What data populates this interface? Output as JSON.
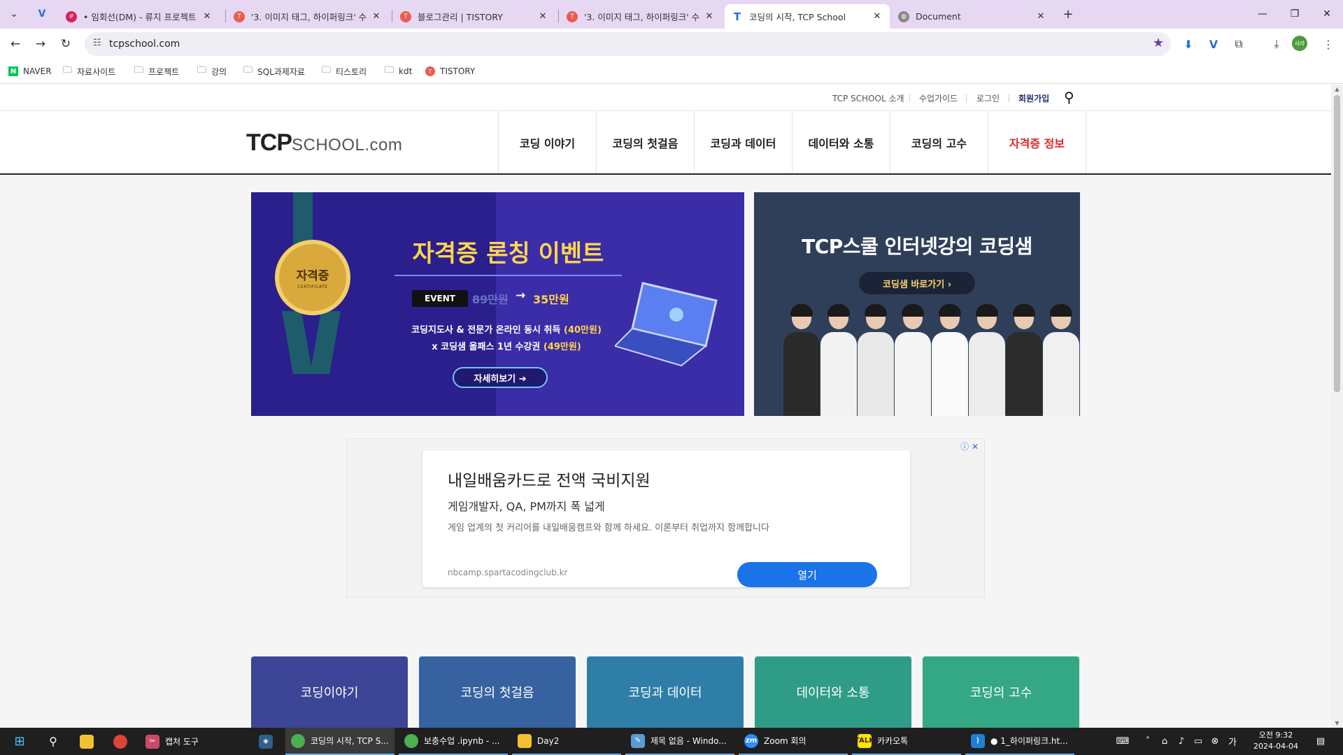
{
  "browser": {
    "tabs": [
      {
        "label": "• 임회선(DM) - 류지 프로젝트",
        "favicon": "slack-icon"
      },
      {
        "label": "'3. 이미지 태그, 하이퍼링크' 수",
        "favicon": "tistory-icon"
      },
      {
        "label": "블로그관리 | TISTORY",
        "favicon": "tistory-icon"
      },
      {
        "label": "'3. 이미지 태그, 하이퍼링크' 수",
        "favicon": "tistory-icon"
      },
      {
        "label": "코딩의 시작, TCP School",
        "favicon": "tcp-icon",
        "active": true
      },
      {
        "label": "Document",
        "favicon": "globe-icon"
      }
    ],
    "url": "tcpschool.com",
    "bookmarks": [
      {
        "label": "NAVER",
        "icon": "naver-icon"
      },
      {
        "label": "자료사이트",
        "icon": "folder-icon"
      },
      {
        "label": "프로젝트",
        "icon": "folder-icon"
      },
      {
        "label": "강의",
        "icon": "folder-icon"
      },
      {
        "label": "SQL과제자료",
        "icon": "folder-icon"
      },
      {
        "label": "티스토리",
        "icon": "folder-icon"
      },
      {
        "label": "kdt",
        "icon": "folder-icon"
      },
      {
        "label": "TISTORY",
        "icon": "tistory-icon"
      }
    ],
    "profile_badge": "사라",
    "accent_color": "#e6d7f2"
  },
  "site": {
    "util_links": [
      "TCP SCHOOL 소개",
      "수업가이드",
      "로그인",
      "회원가입"
    ],
    "logo": {
      "main": "TCP",
      "rest": "SCHOOL.com"
    },
    "gnb": [
      "코딩 이야기",
      "코딩의 첫걸음",
      "코딩과 데이터",
      "데이터와 소통",
      "코딩의 고수",
      "자격증 정보"
    ],
    "banner_left": {
      "medal": "자격증",
      "medal_sub": "CERTIFICATE",
      "headline": "자격증 론칭 이벤트",
      "event_label": "EVENT",
      "price_old": "89만원",
      "price_arrow": "→",
      "price_new": "35만원",
      "line1_a": "코딩지도사 & 전문가 온라인 동시 취득 ",
      "line1_b": "(40만원)",
      "line2_a": "x 코딩샘 올패스 1년 수강권 ",
      "line2_b": "(49만원)",
      "button": "자세히보기 ➔"
    },
    "banner_right": {
      "title": "TCP스쿨 인터넷강의 코딩샘",
      "button": "코딩샘 바로가기  ›"
    },
    "ad": {
      "title": "내일배움카드로 전액 국비지원",
      "subtitle": "게임개발자, QA, PM까지 폭 넓게",
      "description": "게임 업계의 첫 커리어를 내일배움캠프와 함께 하세요. 이론부터 취업까지 함께합니다",
      "url": "nbcamp.spartacodingclub.kr",
      "button": "열기",
      "info_icons": "ⓘ ✕"
    },
    "categories": [
      {
        "label": "코딩이야기",
        "color": "#3d4596"
      },
      {
        "label": "코딩의 첫걸음",
        "color": "#36629f"
      },
      {
        "label": "코딩과 데이터",
        "color": "#2e7ea8"
      },
      {
        "label": "데이터와 소통",
        "color": "#2e9c86"
      },
      {
        "label": "코딩의 고수",
        "color": "#34a785"
      }
    ]
  },
  "taskbar": {
    "items": [
      {
        "label": "캡처 도구",
        "icon": "snipping-tool-icon"
      },
      {
        "label": "코딩의 시작, TCP S...",
        "icon": "chrome-icon"
      },
      {
        "label": "보충수업 .ipynb - ...",
        "icon": "chrome-icon"
      },
      {
        "label": "Day2",
        "icon": "folder-icon"
      },
      {
        "label": "제목 없음 - Windo...",
        "icon": "notepad-icon"
      },
      {
        "label": "Zoom 회의",
        "icon": "zoom-icon"
      },
      {
        "label": "카카오톡",
        "icon": "kakaotalk-icon"
      },
      {
        "label": "● 1_하이퍼링크.ht...",
        "icon": "vscode-icon"
      }
    ],
    "clock_time": "오전 9:32",
    "clock_date": "2024-04-04"
  }
}
